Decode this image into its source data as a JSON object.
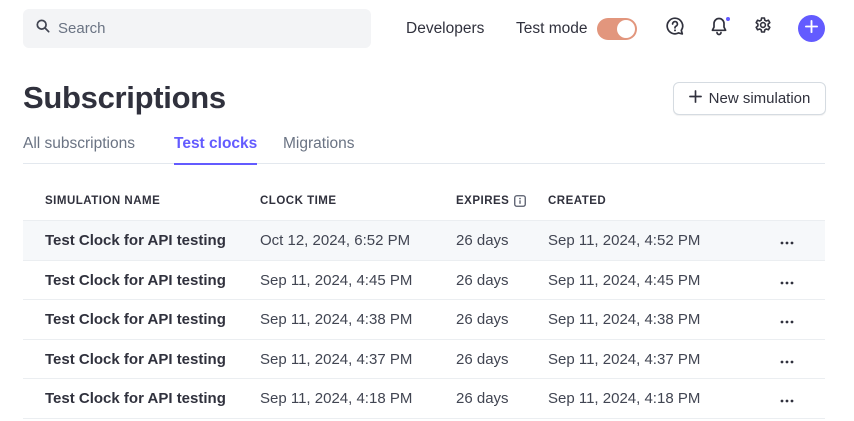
{
  "topbar": {
    "search_placeholder": "Search",
    "developers_label": "Developers",
    "test_mode_label": "Test mode",
    "test_mode_on": true,
    "icons": [
      "search-icon",
      "help-icon",
      "bell-icon",
      "gear-icon",
      "plus-icon"
    ],
    "accent_color": "#635bff",
    "toggle_color": "#e2967d"
  },
  "header": {
    "title": "Subscriptions",
    "new_simulation_label": "New simulation"
  },
  "tabs": [
    {
      "label": "All subscriptions",
      "active": false
    },
    {
      "label": "Test clocks",
      "active": true
    },
    {
      "label": "Migrations",
      "active": false
    }
  ],
  "table": {
    "columns": [
      "SIMULATION NAME",
      "CLOCK TIME",
      "EXPIRES",
      "CREATED"
    ],
    "rows": [
      {
        "name": "Test Clock for API testing",
        "clock_time": "Oct 12, 2024, 6:52 PM",
        "expires": "26 days",
        "created": "Sep 11, 2024, 4:52 PM"
      },
      {
        "name": "Test Clock for API testing",
        "clock_time": "Sep 11, 2024, 4:45 PM",
        "expires": "26 days",
        "created": "Sep 11, 2024, 4:45 PM"
      },
      {
        "name": "Test Clock for API testing",
        "clock_time": "Sep 11, 2024, 4:38 PM",
        "expires": "26 days",
        "created": "Sep 11, 2024, 4:38 PM"
      },
      {
        "name": "Test Clock for API testing",
        "clock_time": "Sep 11, 2024, 4:37 PM",
        "expires": "26 days",
        "created": "Sep 11, 2024, 4:37 PM"
      },
      {
        "name": "Test Clock for API testing",
        "clock_time": "Sep 11, 2024, 4:18 PM",
        "expires": "26 days",
        "created": "Sep 11, 2024, 4:18 PM"
      }
    ]
  }
}
